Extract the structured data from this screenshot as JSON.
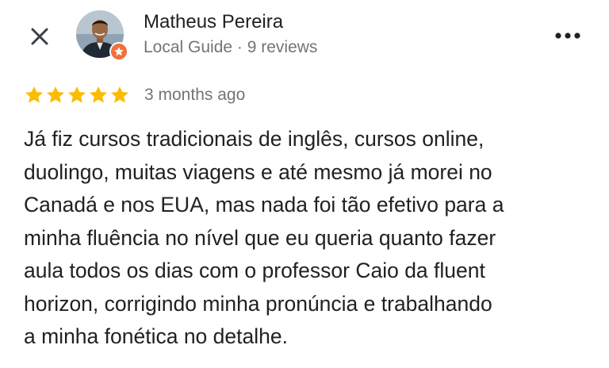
{
  "header": {
    "close_icon": "close-icon",
    "more_icon": "more-options-icon",
    "reviewer": {
      "name": "Matheus Pereira",
      "meta": "Local Guide · 9 reviews",
      "avatar_icon": "avatar-photo",
      "badge_icon": "local-guide-star-icon",
      "badge_color": "#f36f3a"
    }
  },
  "review": {
    "rating": 5,
    "rating_max": 5,
    "star_color": "#fbbc04",
    "date": "3 months ago",
    "text_lines": [
      "Já fiz cursos tradicionais de inglês, cursos online,",
      "duolingo, muitas viagens e até  mesmo já morei no",
      "Canadá e nos EUA, mas nada foi tão efetivo para a",
      "minha fluência no nível que eu queria quanto fazer",
      "aula todos os dias com o professor Caio da fluent",
      "horizon, corrigindo minha pronúncia e  trabalhando",
      "a minha fonética no detalhe."
    ]
  }
}
